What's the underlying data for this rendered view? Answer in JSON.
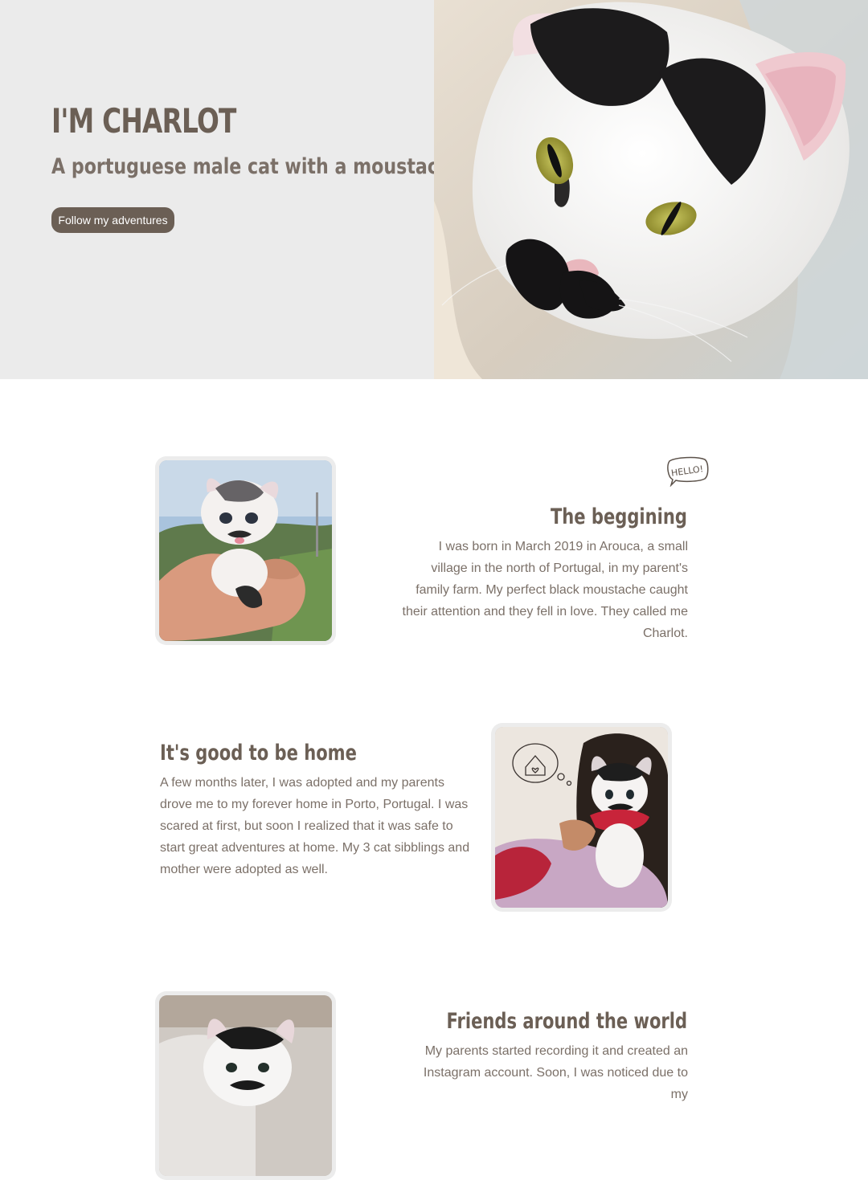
{
  "hero": {
    "title": "I'M CHARLOT",
    "subtitle": "A portuguese male cat with a moustache",
    "button_label": "Follow my adventures"
  },
  "badge": {
    "text": "HELLO!"
  },
  "sections": [
    {
      "heading": "The beggining",
      "text": "I was born in March 2019 in Arouca, a small village in the north of Portugal, in my parent's family farm. My perfect black moustache caught their attention and they fell in love. They called me Charlot."
    },
    {
      "heading": "It's good to be home",
      "text": "A few months later, I was adopted and my parents drove me to my forever home in Porto, Portugal. I was scared at first, but soon I realized that it was safe to start great adventures at home. My 3 cat sibblings and mother were adopted as well."
    },
    {
      "heading": "Friends around the world",
      "text": "My parents started recording it and created an Instagram account. Soon, I was noticed due to my"
    }
  ],
  "colors": {
    "brand_brown": "#6b5f55",
    "hero_background": "#ebebeb",
    "text_muted": "#7b7068",
    "card_frame": "#ececec"
  },
  "icons": {
    "badge": "hello-speech-bubble-icon",
    "thought": "house-heart-thought-bubble-icon"
  }
}
